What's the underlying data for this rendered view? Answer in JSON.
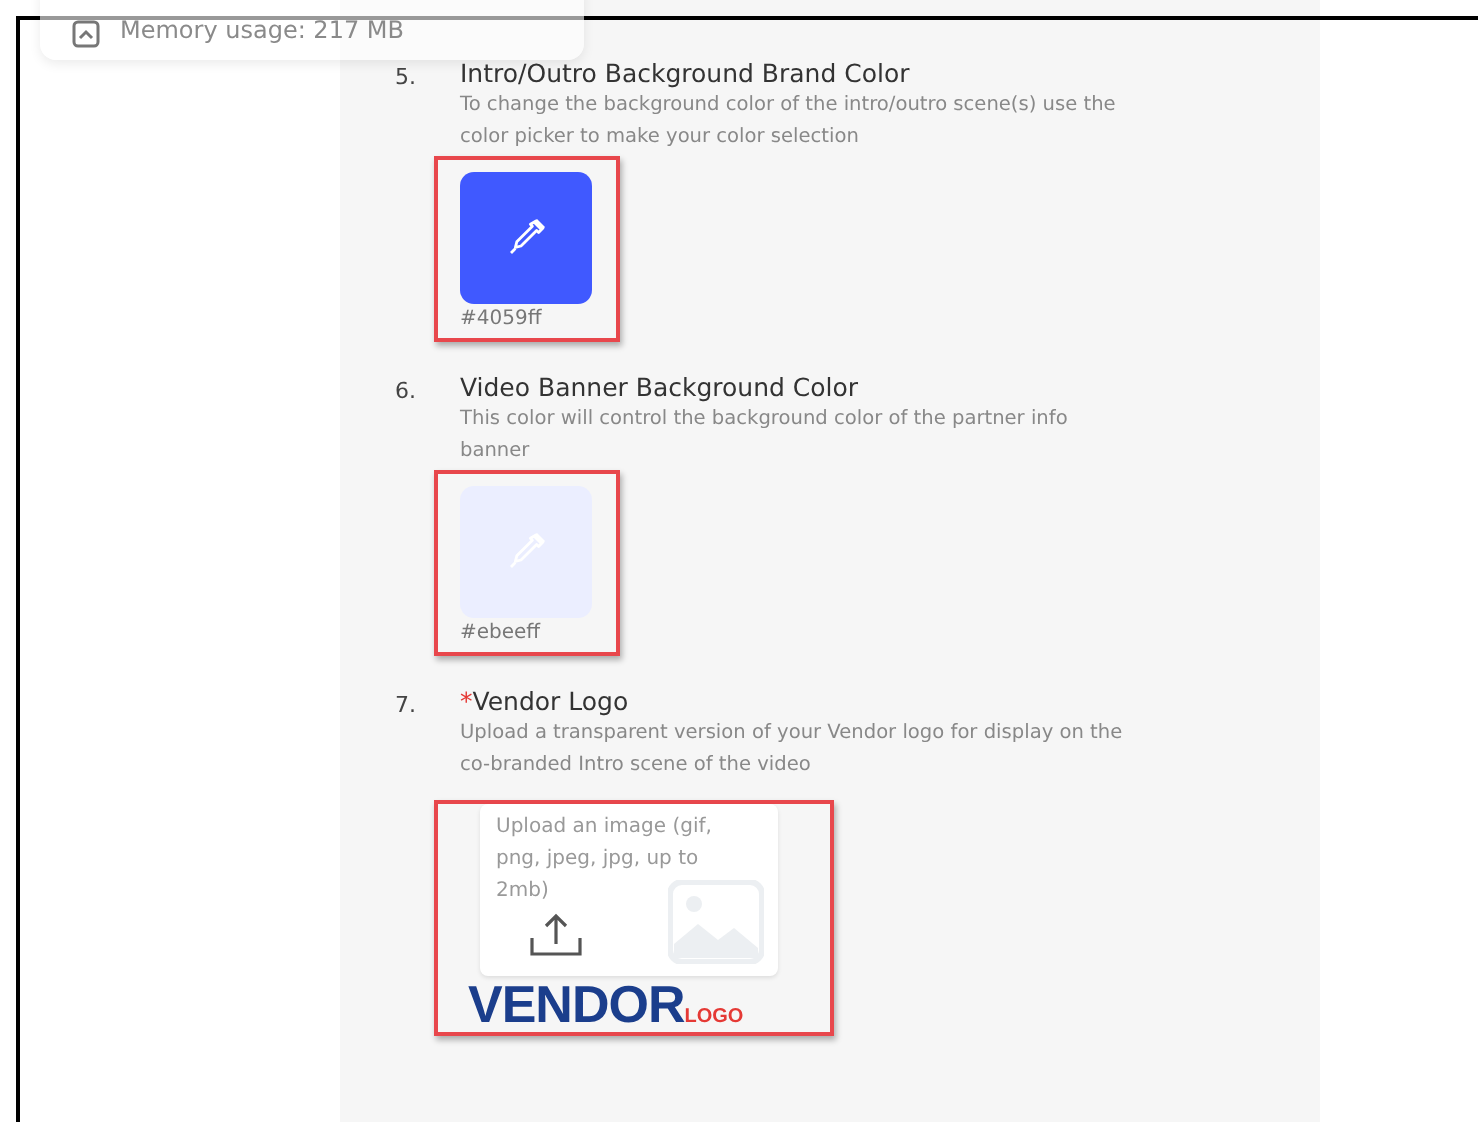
{
  "overlay": {
    "text": "Memory usage: 217 MB"
  },
  "items": [
    {
      "number": "5.",
      "kind": "color",
      "title": "Intro/Outro Background Brand Color",
      "description": "To change the background color of the intro/outro scene(s) use the color picker to make your color selection",
      "color": "#4059ff",
      "value": "#4059ff"
    },
    {
      "number": "6.",
      "kind": "color",
      "title": "Video Banner Background Color",
      "description": "This color will control the background color of the partner info banner",
      "color": "#ebeeff",
      "value": "#ebeeff"
    },
    {
      "number": "7.",
      "kind": "upload",
      "required_mark": "*",
      "title": "Vendor Logo",
      "description": "Upload a transparent version of your Vendor logo for display on the co-branded Intro scene of the video",
      "upload_text": "Upload an image (gif, png, jpeg, jpg, up to 2mb)",
      "logo": {
        "main": "VENDOR",
        "sub": "LOGO"
      }
    }
  ]
}
